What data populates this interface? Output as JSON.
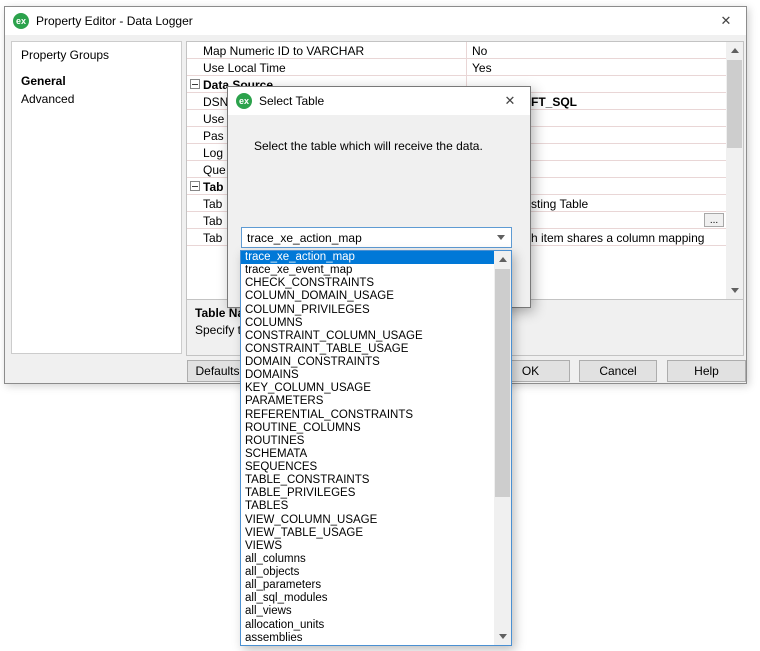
{
  "accent_color": "#0078d7",
  "selection_color": "#0078d7",
  "main_window": {
    "icon_text": "ex",
    "title": "Property Editor - Data Logger",
    "close_glyph": "✕",
    "left_panel": {
      "heading": "Property Groups",
      "items": [
        "General",
        "Advanced"
      ]
    },
    "grid": {
      "rows": [
        {
          "name": "Map Numeric ID to VARCHAR",
          "value": "No"
        },
        {
          "name": "Use Local Time",
          "value": "Yes"
        },
        {
          "name": "Data Source",
          "value": "",
          "group": true
        },
        {
          "name": "DSN",
          "value": "FT_SQL"
        },
        {
          "name": "Use",
          "value": ""
        },
        {
          "name": "Pas",
          "value": ""
        },
        {
          "name": "Log",
          "value": ""
        },
        {
          "name": "Que",
          "value": ""
        },
        {
          "name": "Tab",
          "value": "",
          "group": true
        },
        {
          "name": "Tab",
          "value": "sting Table"
        },
        {
          "name": "Tab",
          "value": "",
          "button": "..."
        },
        {
          "name": "Tab",
          "value": "h item shares a column mapping"
        }
      ]
    },
    "description": {
      "title": "Table Na",
      "text": "Specify the"
    },
    "buttons": {
      "defaults": "Defaults",
      "ok": "OK",
      "cancel": "Cancel",
      "help": "Help"
    }
  },
  "select_table_dialog": {
    "icon_text": "ex",
    "title": "Select Table",
    "close_glyph": "✕",
    "message": "Select the table which will receive the data.",
    "combobox": {
      "value": "trace_xe_action_map"
    },
    "selected_index": 0,
    "tables": [
      "trace_xe_action_map",
      "trace_xe_event_map",
      "CHECK_CONSTRAINTS",
      "COLUMN_DOMAIN_USAGE",
      "COLUMN_PRIVILEGES",
      "COLUMNS",
      "CONSTRAINT_COLUMN_USAGE",
      "CONSTRAINT_TABLE_USAGE",
      "DOMAIN_CONSTRAINTS",
      "DOMAINS",
      "KEY_COLUMN_USAGE",
      "PARAMETERS",
      "REFERENTIAL_CONSTRAINTS",
      "ROUTINE_COLUMNS",
      "ROUTINES",
      "SCHEMATA",
      "SEQUENCES",
      "TABLE_CONSTRAINTS",
      "TABLE_PRIVILEGES",
      "TABLES",
      "VIEW_COLUMN_USAGE",
      "VIEW_TABLE_USAGE",
      "VIEWS",
      "all_columns",
      "all_objects",
      "all_parameters",
      "all_sql_modules",
      "all_views",
      "allocation_units",
      "assemblies"
    ]
  }
}
